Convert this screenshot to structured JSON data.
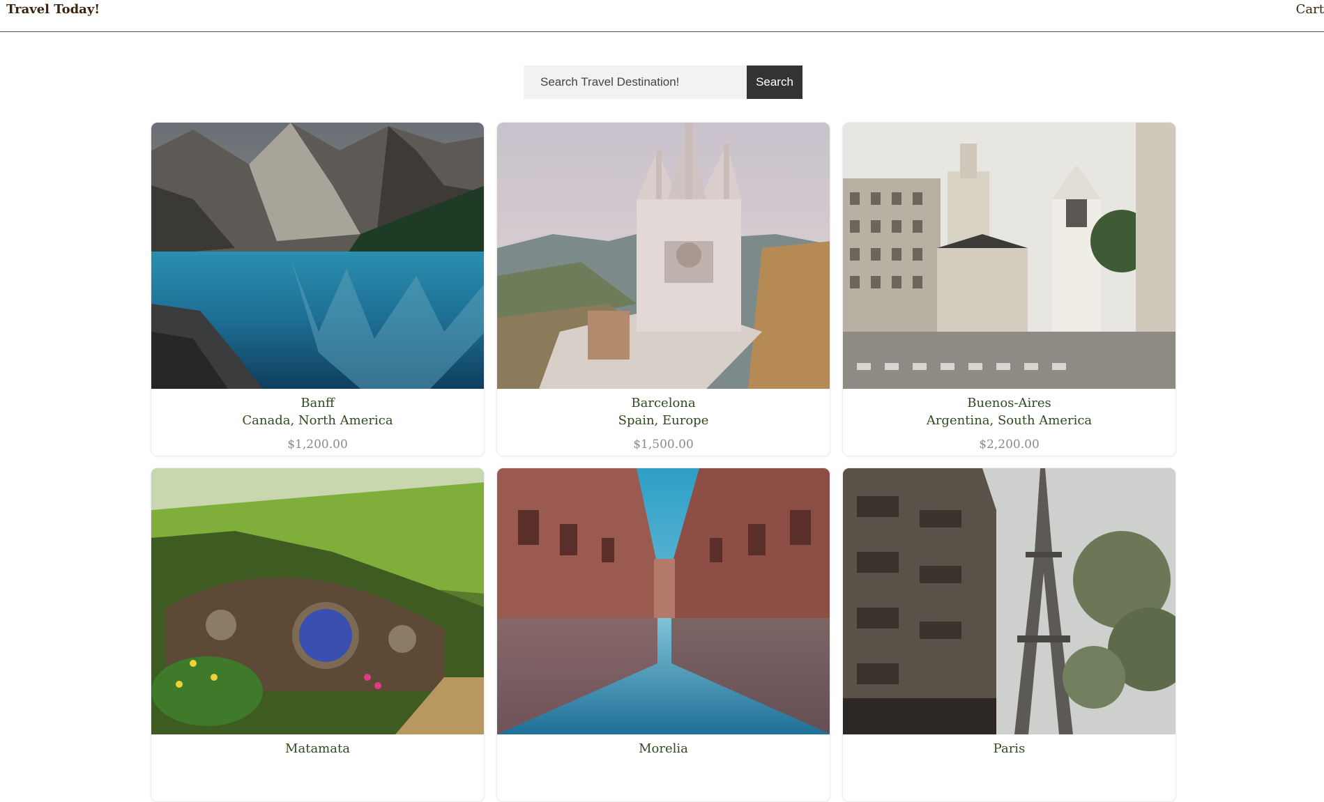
{
  "header": {
    "brand": "Travel Today!",
    "cart_label": "Cart"
  },
  "search": {
    "placeholder": "Search Travel Destination!",
    "button_label": "Search"
  },
  "destinations": [
    {
      "city": "Banff",
      "country": "Canada, North America",
      "price": "$1,200.00",
      "image": "mountain-lake-photo"
    },
    {
      "city": "Barcelona",
      "country": "Spain, Europe",
      "price": "$1,500.00",
      "image": "cathedral-photo"
    },
    {
      "city": "Buenos-Aires",
      "country": "Argentina, South America",
      "price": "$2,200.00",
      "image": "city-street-photo"
    },
    {
      "city": "Matamata",
      "country": "",
      "price": "",
      "image": "hobbit-house-photo"
    },
    {
      "city": "Morelia",
      "country": "",
      "price": "",
      "image": "reflection-street-photo"
    },
    {
      "city": "Paris",
      "country": "",
      "price": "",
      "image": "eiffel-tower-photo"
    }
  ]
}
